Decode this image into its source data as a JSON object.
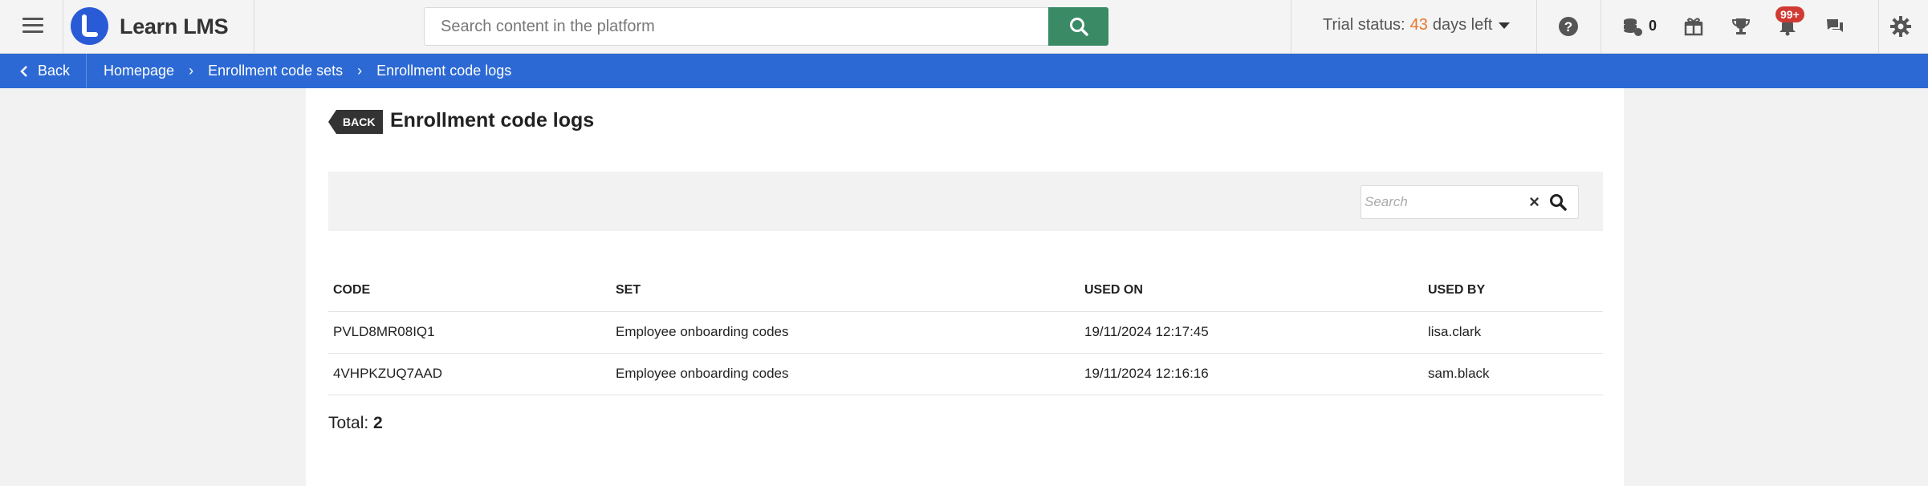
{
  "app": {
    "name": "Learn LMS"
  },
  "header": {
    "search_placeholder": "Search content in the platform",
    "trial_prefix": "Trial status:",
    "trial_days": "43",
    "trial_suffix": "days left",
    "coins_count": "0",
    "notifications_badge": "99+"
  },
  "breadcrumb": {
    "back_label": "Back",
    "items": [
      "Homepage",
      "Enrollment code sets",
      "Enrollment code logs"
    ]
  },
  "page": {
    "back_tag": "BACK",
    "title": "Enrollment code logs",
    "search_placeholder": "Search"
  },
  "table": {
    "columns": [
      "CODE",
      "SET",
      "USED ON",
      "USED BY"
    ],
    "rows": [
      {
        "code": "PVLD8MR08IQ1",
        "set": "Employee onboarding codes",
        "used_on": "19/11/2024 12:17:45",
        "used_by": "lisa.clark"
      },
      {
        "code": "4VHPKZUQ7AAD",
        "set": "Employee onboarding codes",
        "used_on": "19/11/2024 12:16:16",
        "used_by": "sam.black"
      }
    ]
  },
  "footer": {
    "total_label": "Total:",
    "total_value": "2"
  },
  "colors": {
    "brand_blue": "#2c69d4",
    "search_green": "#3a8a66",
    "trial_orange": "#e8762c",
    "badge_red": "#d03a32"
  }
}
